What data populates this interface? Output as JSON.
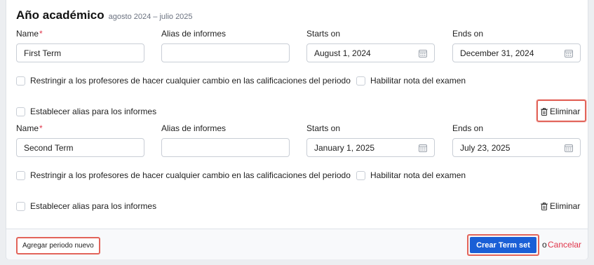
{
  "header": {
    "title": "Año académico",
    "subtitle": "agosto 2024 – julio 2025"
  },
  "labels": {
    "name": "Name",
    "required_mark": "*",
    "alias": "Alias de informes",
    "starts": "Starts on",
    "ends": "Ends on",
    "restrict": "Restringir a los profesores de hacer cualquier cambio en las calificaciones del periodo",
    "exam": "Habilitar nota del examen",
    "set_alias": "Establecer alias para los informes",
    "delete": "Eliminar"
  },
  "terms": [
    {
      "name": "First Term",
      "alias": "",
      "starts_on": "August 1, 2024",
      "ends_on": "December 31, 2024"
    },
    {
      "name": "Second Term",
      "alias": "",
      "starts_on": "January 1, 2025",
      "ends_on": "July 23, 2025"
    }
  ],
  "footer": {
    "add_label": "Agregar periodo nuevo",
    "create_label": "Crear Term set",
    "or_label": "o",
    "cancel_label": "Cancelar"
  },
  "colors": {
    "primary": "#1a5fd6",
    "danger": "#e0364b",
    "highlight": "#e2645a"
  }
}
